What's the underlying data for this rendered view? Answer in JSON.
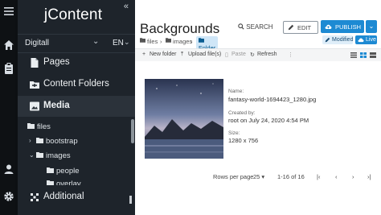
{
  "app": {
    "brand": "jContent"
  },
  "nav": {
    "site": "Digitall",
    "language": "EN",
    "menu": [
      {
        "label": "Pages",
        "icon": "file-icon"
      },
      {
        "label": "Content Folders",
        "icon": "folder-icon"
      },
      {
        "label": "Media",
        "icon": "image-icon"
      }
    ],
    "tree": [
      {
        "label": "files",
        "depth": 0,
        "expanded": true
      },
      {
        "label": "bootstrap",
        "depth": 1,
        "expanded": false
      },
      {
        "label": "images",
        "depth": 1,
        "expanded": true
      },
      {
        "label": "people",
        "depth": 2
      },
      {
        "label": "overlay",
        "depth": 2
      }
    ],
    "additional": "Additional"
  },
  "header": {
    "title": "Backgrounds",
    "breadcrumb": [
      "files",
      "images",
      "Folder"
    ],
    "search": "SEARCH",
    "edit": "EDIT",
    "publish": "PUBLISH",
    "badges": [
      "Modified",
      "Live"
    ]
  },
  "toolbar": [
    "New folder",
    "Upload file(s)",
    "Paste",
    "Refresh"
  ],
  "file": {
    "name_label": "Name:",
    "name": "fantasy-world-1694423_1280.jpg",
    "created_label": "Created by:",
    "created": "root on July 24, 2020 4:54 PM",
    "size_label": "Size:",
    "size": "1280 x 756"
  },
  "pagination": {
    "rows_label": "Rows per page",
    "rows": "25",
    "range": "1-16 of 16"
  },
  "colors": {
    "accent": "#1d8ad3",
    "nav_bg": "#1e242b",
    "iconbar_bg": "#0e1114"
  }
}
